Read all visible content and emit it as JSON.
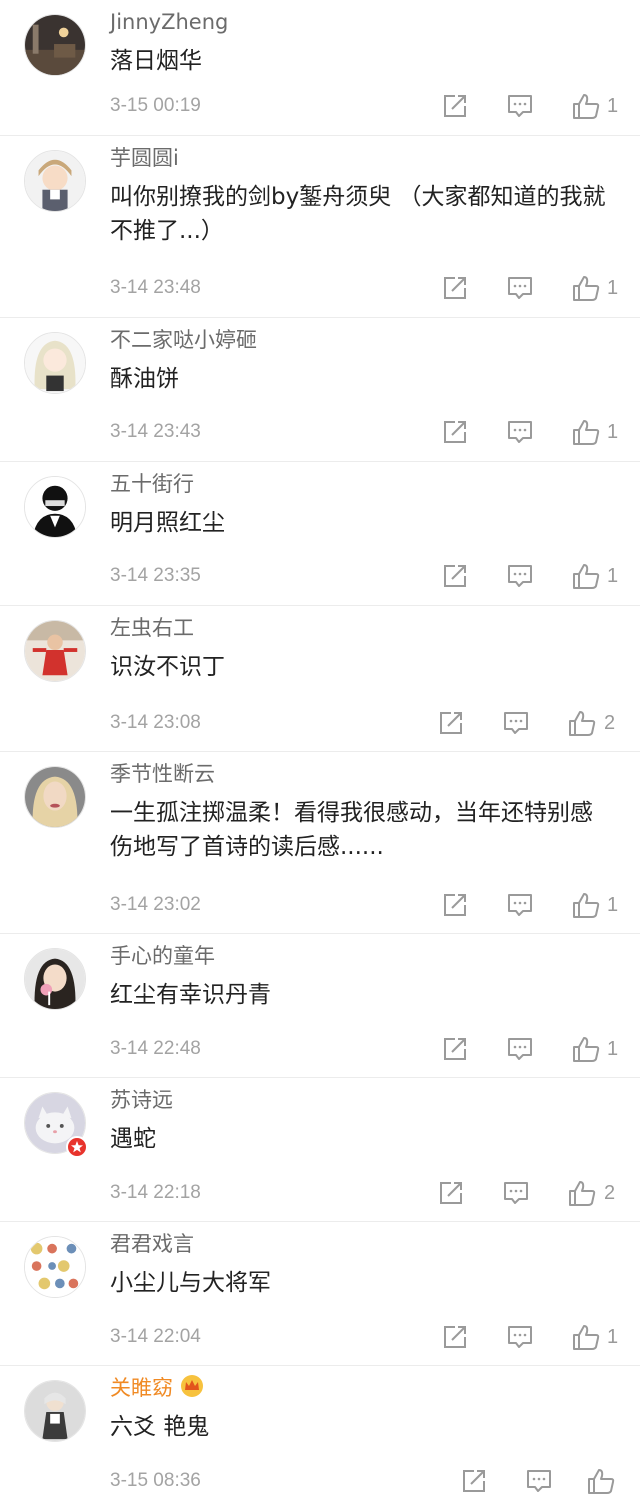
{
  "comments": [
    {
      "username": "JinnyZheng",
      "content": "落日烟华",
      "time": "3-15 00:19",
      "likes": "1",
      "avatar": "night-street-photo"
    },
    {
      "username": "芋圆圆i",
      "content": "叫你别撩我的剑by錾舟须臾 （大家都知道的我就不推了...）",
      "time": "3-14 23:48",
      "likes": "1",
      "avatar": "anime-boy"
    },
    {
      "username": "不二家哒小婷砸",
      "content": "酥油饼",
      "time": "3-14 23:43",
      "likes": "1",
      "avatar": "long-hair-character"
    },
    {
      "username": "五十街行",
      "content": "明月照红尘",
      "time": "3-14 23:35",
      "likes": "1",
      "avatar": "masked-figure"
    },
    {
      "username": "左虫右工",
      "content": "识汝不识丁",
      "time": "3-14 23:08",
      "likes": "2",
      "avatar": "child-red-dress"
    },
    {
      "username": "季节性断云",
      "content": "一生孤注掷温柔！看得我很感动，当年还特别感伤地写了首诗的读后感......",
      "time": "3-14 23:02",
      "likes": "1",
      "avatar": "blonde-woman"
    },
    {
      "username": "手心的童年",
      "content": "红尘有幸识丹青",
      "time": "3-14 22:48",
      "likes": "1",
      "avatar": "girl-lollipop"
    },
    {
      "username": "苏诗远",
      "content": "遇蛇",
      "time": "3-14 22:18",
      "likes": "2",
      "avatar": "cat-photo",
      "verified": true
    },
    {
      "username": "君君戏言",
      "content": "小尘儿与大将军",
      "time": "3-14 22:04",
      "likes": "1",
      "avatar": "sticker-grid"
    },
    {
      "username": "关睢窈",
      "content": "六爻 艳鬼",
      "time": "3-15 08:36",
      "likes": "",
      "avatar": "figurine",
      "vip": true
    }
  ],
  "colors": {
    "username": "#6b6b6b",
    "vip_username": "#f08a24",
    "timestamp": "#a3a3a3",
    "icon": "#9a9a9a",
    "divider": "#ececec"
  },
  "icons": {
    "repost": "repost-icon",
    "comment": "comment-icon",
    "like": "like-icon",
    "verified": "verified-badge-icon",
    "vip": "crown-icon"
  }
}
